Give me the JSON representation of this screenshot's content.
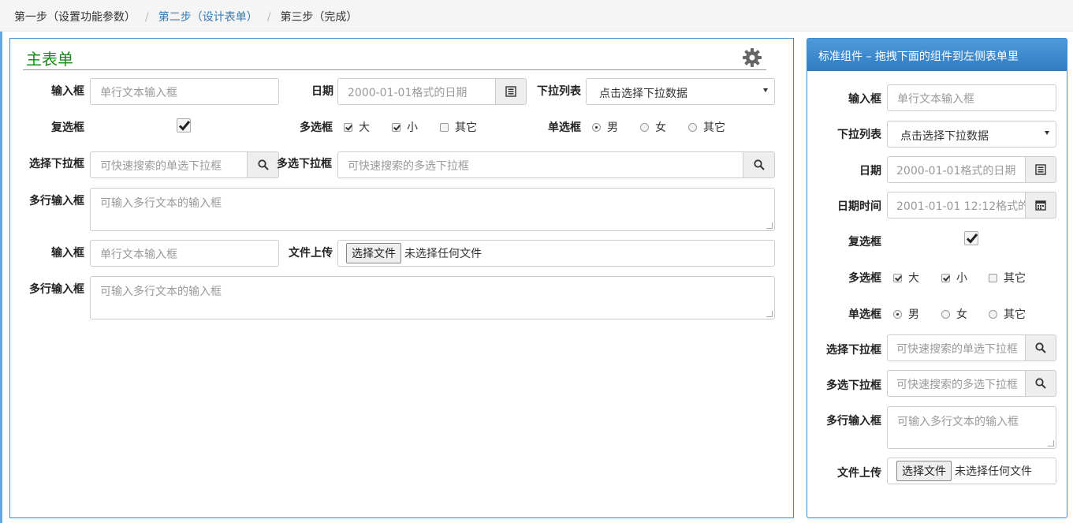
{
  "breadcrumb": {
    "step1": "第一步（设置功能参数）",
    "step2": "第二步（设计表单）",
    "step3": "第三步（完成）",
    "separator": "/"
  },
  "colors": {
    "accent": "#3c8dcf",
    "title_green": "#1a8a1a",
    "link": "#337ab7"
  },
  "main": {
    "title": "主表单",
    "settings_icon": "gear-icon",
    "text1": {
      "label": "输入框",
      "placeholder": "单行文本输入框"
    },
    "date": {
      "label": "日期",
      "placeholder": "2000-01-01格式的日期",
      "icon": "list-icon"
    },
    "dropdown": {
      "label": "下拉列表",
      "value": "点击选择下拉数据"
    },
    "checkbox": {
      "label": "复选框",
      "checked": true
    },
    "multi": {
      "label": "多选框",
      "options": [
        "大",
        "小",
        "其它"
      ]
    },
    "radio": {
      "label": "单选框",
      "options": [
        "男",
        "女",
        "其它"
      ]
    },
    "select_single": {
      "label": "选择下拉框",
      "placeholder": "可快速搜索的单选下拉框",
      "icon": "search-icon"
    },
    "select_multi": {
      "label": "多选下拉框",
      "placeholder": "可快速搜索的多选下拉框",
      "icon": "search-icon"
    },
    "textarea1": {
      "label": "多行输入框",
      "placeholder": "可输入多行文本的输入框"
    },
    "text2": {
      "label": "输入框",
      "placeholder": "单行文本输入框"
    },
    "upload": {
      "label": "文件上传",
      "button": "选择文件",
      "status": "未选择任何文件"
    },
    "textarea2": {
      "label": "多行输入框",
      "placeholder": "可输入多行文本的输入框"
    }
  },
  "side": {
    "header": "标准组件 – 拖拽下面的组件到左侧表单里",
    "text": {
      "label": "输入框",
      "placeholder": "单行文本输入框"
    },
    "dropdown": {
      "label": "下拉列表",
      "value": "点击选择下拉数据"
    },
    "date": {
      "label": "日期",
      "placeholder": "2000-01-01格式的日期",
      "icon": "list-icon"
    },
    "datetime": {
      "label": "日期时间",
      "placeholder": "2001-01-01 12:12格式的",
      "icon": "calendar-icon"
    },
    "checkbox": {
      "label": "复选框",
      "checked": true
    },
    "multi": {
      "label": "多选框",
      "options": [
        "大",
        "小",
        "其它"
      ]
    },
    "radio": {
      "label": "单选框",
      "options": [
        "男",
        "女",
        "其它"
      ]
    },
    "select_single": {
      "label": "选择下拉框",
      "placeholder": "可快速搜索的单选下拉框",
      "icon": "search-icon"
    },
    "select_multi": {
      "label": "多选下拉框",
      "placeholder": "可快速搜索的多选下拉框",
      "icon": "search-icon"
    },
    "textarea": {
      "label": "多行输入框",
      "placeholder": "可输入多行文本的输入框"
    },
    "upload": {
      "label": "文件上传",
      "button": "选择文件",
      "status": "未选择任何文件"
    }
  }
}
